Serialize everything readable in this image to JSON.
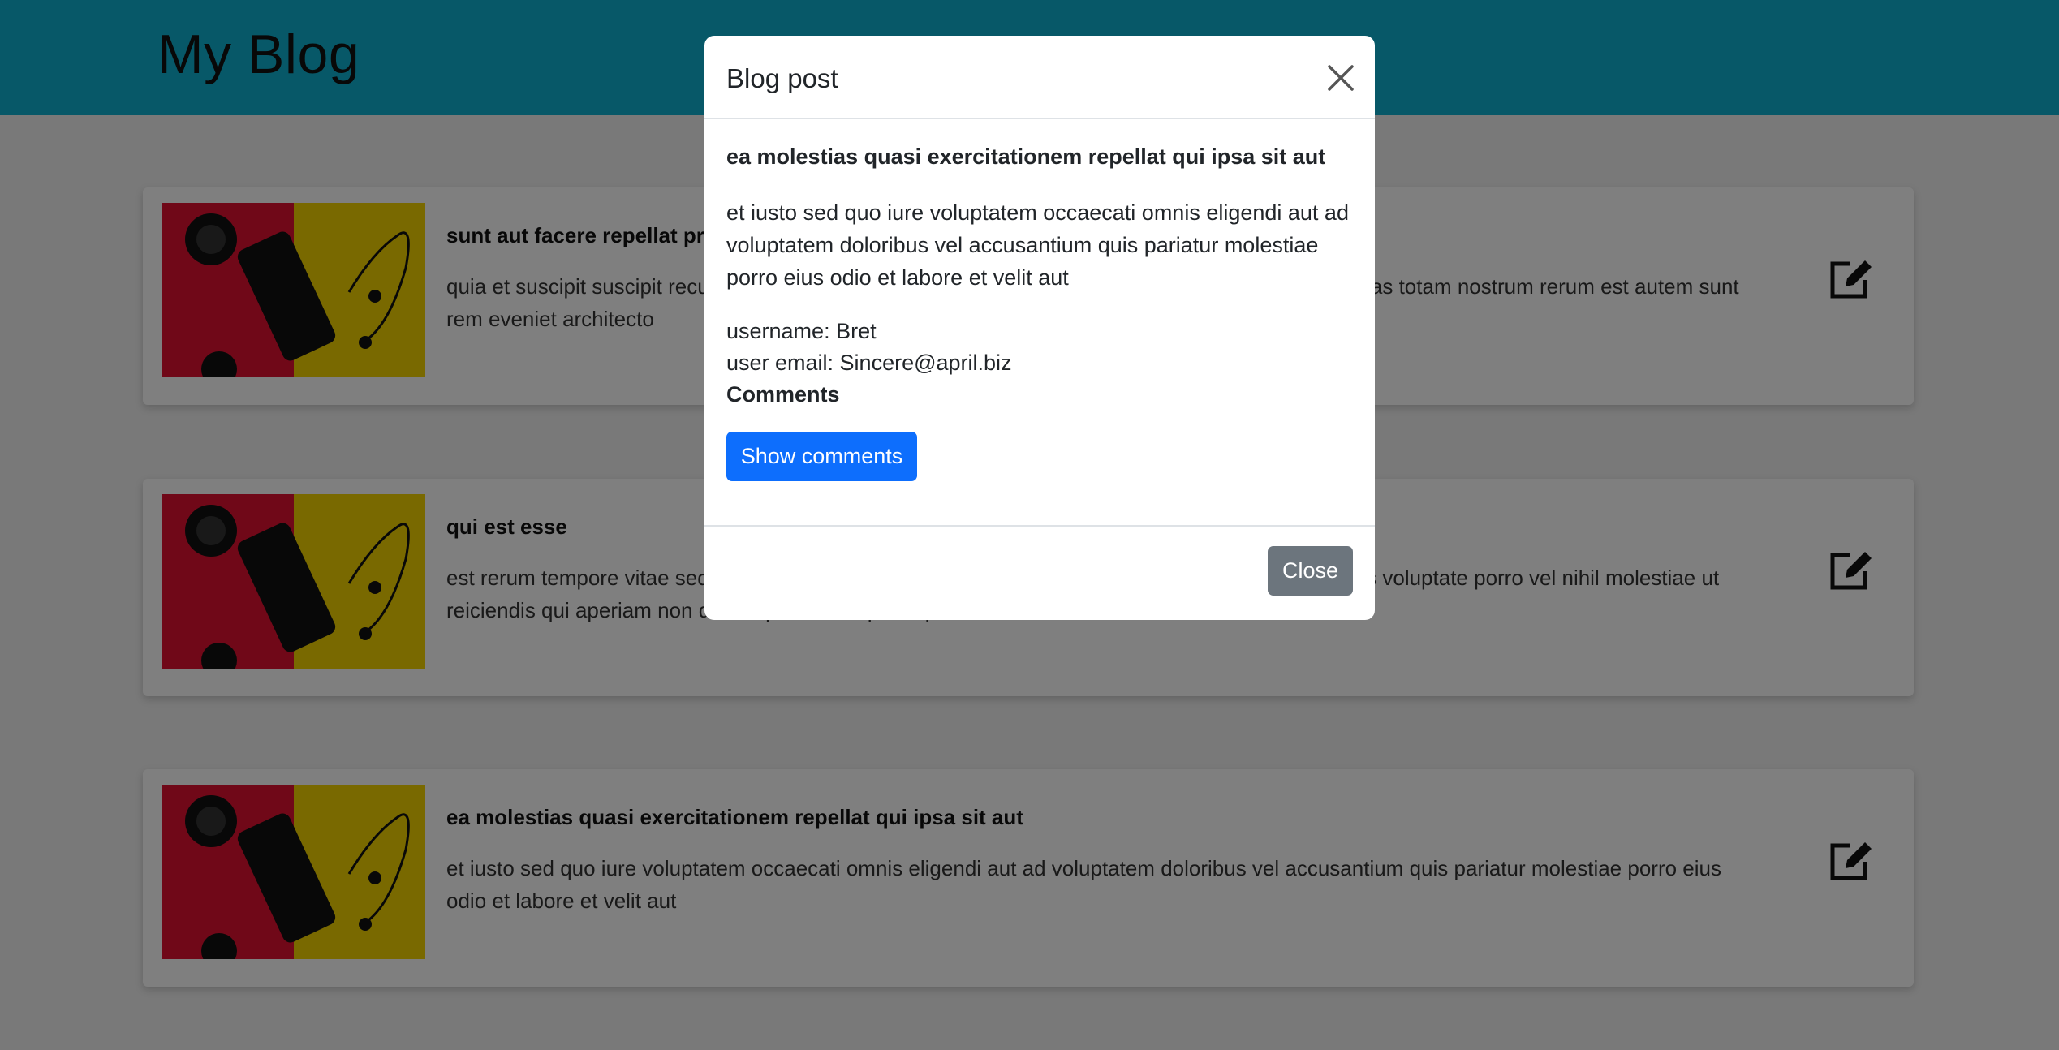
{
  "header": {
    "title": "My Blog"
  },
  "posts": [
    {
      "title": "sunt aut facere repellat provident occaecati excepturi optio reprehenderit",
      "body": "quia et suscipit suscipit recusandae consequuntur expedita et cum reprehenderit molestiae ut ut quas totam nostrum rerum est autem sunt rem eveniet architecto"
    },
    {
      "title": "qui est esse",
      "body": "est rerum tempore vitae sequi sint nihil reprehenderit dolor beatae ea dolores neque fugiat blanditiis voluptate porro vel nihil molestiae ut reiciendis qui aperiam non debitis possimus qui neque nisi nulla"
    },
    {
      "title": "ea molestias quasi exercitationem repellat qui ipsa sit aut",
      "body": "et iusto sed quo iure voluptatem occaecati omnis eligendi aut ad voluptatem doloribus vel accusantium quis pariatur molestiae porro eius odio et labore et velit aut"
    }
  ],
  "modal": {
    "title": "Blog post",
    "post_title": "ea molestias quasi exercitationem repellat qui ipsa sit aut",
    "post_body": "et iusto sed quo iure voluptatem occaecati omnis eligendi aut ad voluptatem doloribus vel accusantium quis pariatur molestiae porro eius odio et labore et velit aut",
    "username": "username: Bret",
    "email": "user email: Sincere@april.biz",
    "comments_heading": "Comments",
    "show_comments_label": "Show comments",
    "close_label": "Close"
  },
  "colors": {
    "header_bg": "#0fb0d0",
    "primary": "#0d6efd",
    "secondary": "#6c757d"
  },
  "icons": {
    "close": "close-icon",
    "edit": "edit-icon"
  }
}
